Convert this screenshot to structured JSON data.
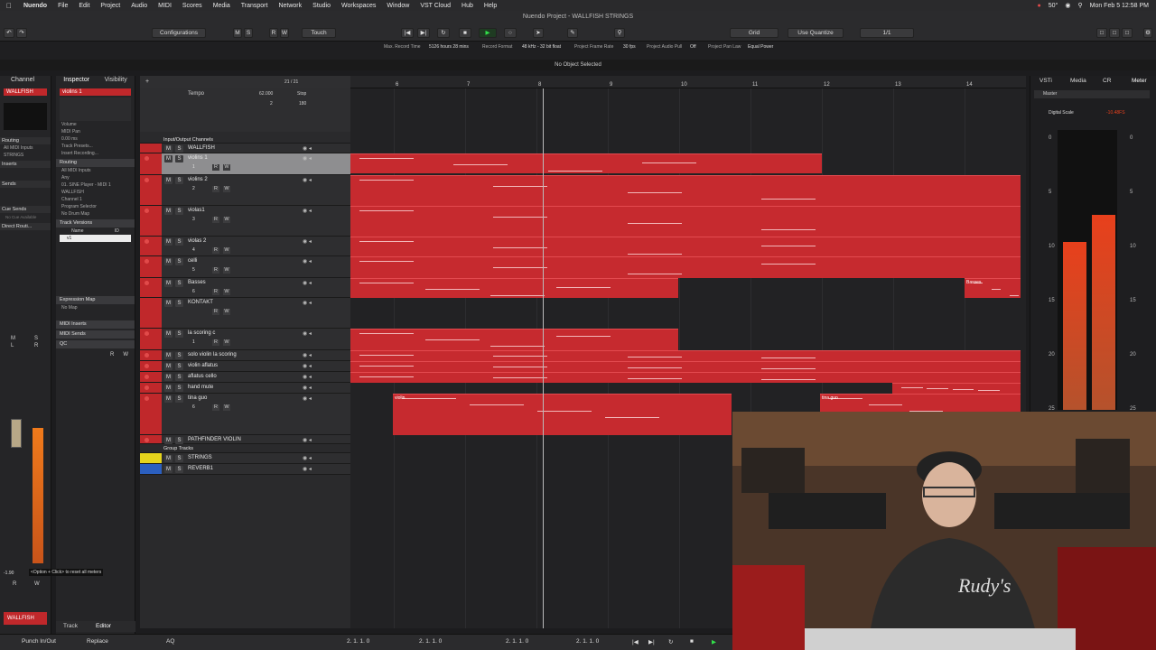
{
  "menubar": {
    "app": "Nuendo",
    "items": [
      "File",
      "Edit",
      "Project",
      "Audio",
      "MIDI",
      "Scores",
      "Media",
      "Transport",
      "Network",
      "Studio",
      "Workspaces",
      "Window",
      "VST Cloud",
      "Hub",
      "Help"
    ],
    "temp": "50°",
    "datetime": "Mon Feb 5  12:58 PM"
  },
  "window": {
    "title": "Nuendo Project - WALLFISH STRINGS"
  },
  "toolbar": {
    "configurations": "Configurations",
    "automode": "Touch",
    "snap": "Grid",
    "quantize": "Use Quantize",
    "quantize_value": "1/1"
  },
  "statusbar": {
    "items": [
      "Max. Record Time",
      "5126 hours 28 mins",
      "Record Format",
      "48 kHz - 32 bit float",
      "Project Frame Rate",
      "30 fps",
      "Project Audio Pull",
      "Off",
      "Project Pan Law",
      "Equal Power"
    ],
    "selection": "No Object Selected"
  },
  "channel": {
    "tab": "Channel",
    "name": "WALLFISH",
    "sections": [
      "Routing",
      "Inserts",
      "Sends",
      "Cue Sends",
      "Direct Routi..."
    ],
    "routing_in": "All MIDI Inputs",
    "routing_out": "STRINGS",
    "no_cue": "No Cue Available",
    "ms": [
      "M",
      "S",
      "L",
      "R"
    ],
    "hint": "<Option + Click> to reset all meters",
    "val": "-1.90",
    "rw": [
      "R",
      "W"
    ],
    "footer": "WALLFISH"
  },
  "inspector": {
    "tab": "Inspector",
    "tab2": "Visibility",
    "track": "violins 1",
    "volume": "Volume",
    "off": "Off",
    "midi_pan": "MIDI Pan",
    "db": "0.00 ms",
    "presets": "Track Presets...",
    "insert_rec": "Insert Recording...",
    "routing": "Routing",
    "in": "All MIDI Inputs",
    "any": "Any",
    "out": "01. SINE Player - MIDI 1",
    "wallfish": "WALLFISH",
    "channel": "Channel 1",
    "program": "Program Selector",
    "drum": "No Drum Map",
    "versions": "Track Versions",
    "col_name": "Name",
    "col_id": "ID",
    "version1": "v1",
    "expmap": "Expression Map",
    "nomap": "No Map",
    "midi_inserts": "MIDI Inserts",
    "midi_sends": "MIDI Sends",
    "qc": "QC",
    "rw": [
      "R",
      "W"
    ],
    "tabs": [
      "Track",
      "Editor"
    ]
  },
  "tracklist": {
    "count": "21 / 21",
    "tempo": "Tempo",
    "tempo_val": "62.000",
    "tempo_mode": "Stop",
    "sig": "2",
    "sig2": "180",
    "tracks": [
      {
        "name": "Input/Output Channels",
        "type": "folder"
      },
      {
        "name": "WALLFISH",
        "type": "instr"
      },
      {
        "name": "violins 1",
        "type": "midi",
        "num": "1"
      },
      {
        "name": "violins 2",
        "type": "midi",
        "num": "2"
      },
      {
        "name": "violas1",
        "type": "midi",
        "num": "3"
      },
      {
        "name": "violas 2",
        "type": "midi",
        "num": "4"
      },
      {
        "name": "celli",
        "type": "midi",
        "num": "5"
      },
      {
        "name": "Basses",
        "type": "midi",
        "num": "6"
      },
      {
        "name": "KONTAKT",
        "type": "instr"
      },
      {
        "name": "la scoring c",
        "type": "midi",
        "num": "1"
      },
      {
        "name": "solo violin la scoring",
        "type": "midi"
      },
      {
        "name": "violin aflatus",
        "type": "midi"
      },
      {
        "name": "aflatus cello",
        "type": "midi"
      },
      {
        "name": "hand mute",
        "type": "midi"
      },
      {
        "name": "tina guo",
        "type": "midi",
        "num": "6"
      },
      {
        "name": "PATHFINDER VIOLIN",
        "type": "midi"
      },
      {
        "name": "Group Tracks",
        "type": "folder"
      },
      {
        "name": "STRINGS",
        "type": "group"
      },
      {
        "name": "REVERB1",
        "type": "fx"
      }
    ],
    "ms": [
      "M",
      "S"
    ],
    "rw": [
      "R",
      "W"
    ]
  },
  "ruler": {
    "bars": [
      "6",
      "7",
      "8",
      "9",
      "10",
      "11",
      "12",
      "13",
      "14"
    ]
  },
  "parts": {
    "basses_label": "Basses",
    "violin_label": "violin",
    "tina_label": "tina guo"
  },
  "rightpane": {
    "tabs": [
      "VSTi",
      "Media",
      "CR",
      "Meter"
    ],
    "master": "Master",
    "scale": "Digital Scale",
    "peak": "-10.48FS",
    "ticks": [
      "0",
      "5",
      "10",
      "15",
      "20",
      "25"
    ],
    "levels": [
      0.62,
      0.72
    ]
  },
  "transport": {
    "punch": "Punch In/Out",
    "mode": "Replace",
    "aq": "AQ",
    "pos1": "2. 1. 1.   0",
    "pos2": "2. 1. 1.   0",
    "pos3": "2. 1. 1.   0",
    "pos4": "2. 1. 1.   0"
  }
}
